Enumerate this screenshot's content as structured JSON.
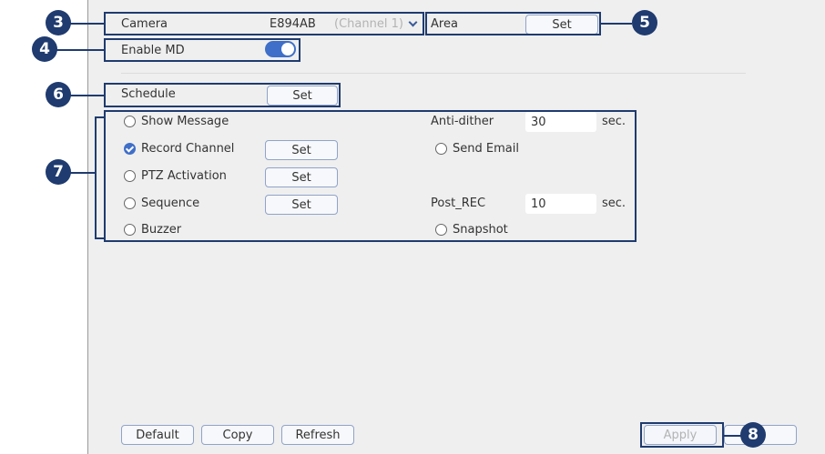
{
  "camera": {
    "label": "Camera",
    "value": "E894AB",
    "channel": "(Channel 1)"
  },
  "area": {
    "label": "Area",
    "button": "Set"
  },
  "enable_md": {
    "label": "Enable MD",
    "on": true
  },
  "schedule": {
    "label": "Schedule",
    "button": "Set"
  },
  "actions": {
    "show_message": {
      "label": "Show Message",
      "checked": false
    },
    "record_channel": {
      "label": "Record Channel",
      "checked": true,
      "button": "Set"
    },
    "ptz_activation": {
      "label": "PTZ Activation",
      "checked": false,
      "button": "Set"
    },
    "sequence": {
      "label": "Sequence",
      "checked": false,
      "button": "Set"
    },
    "buzzer": {
      "label": "Buzzer",
      "checked": false
    },
    "send_email": {
      "label": "Send Email",
      "checked": false
    },
    "snapshot": {
      "label": "Snapshot",
      "checked": false
    }
  },
  "anti_dither": {
    "label": "Anti-dither",
    "value": "30",
    "unit": "sec."
  },
  "post_rec": {
    "label": "Post_REC",
    "value": "10",
    "unit": "sec."
  },
  "footer": {
    "default": "Default",
    "copy": "Copy",
    "refresh": "Refresh",
    "apply": "Apply"
  },
  "callouts": [
    "3",
    "4",
    "5",
    "6",
    "7",
    "8"
  ],
  "colors": {
    "callout": "#1f3b6f",
    "accent": "#3f6fc8",
    "panel": "#efefef"
  }
}
